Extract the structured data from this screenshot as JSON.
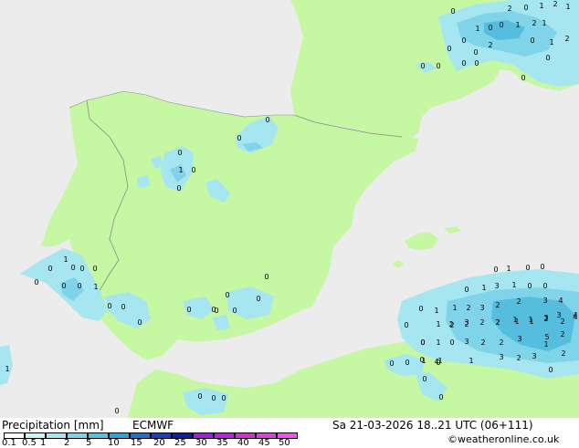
{
  "legend": {
    "title": "Precipitation [mm]",
    "model": "ECMWF",
    "datetime": "Sa 21-03-2026 18..21 UTC (06+111)",
    "credit": "©weatheronline.co.uk",
    "ticks": [
      "0.1",
      "0.5",
      "1",
      "2",
      "5",
      "10",
      "15",
      "20",
      "25",
      "30",
      "35",
      "40",
      "45",
      "50"
    ],
    "colors": [
      "#ffffff",
      "#cdf3f7",
      "#a5e8f0",
      "#7ad7ea",
      "#4cc6e0",
      "#2aa9d8",
      "#1f74d0",
      "#1940c0",
      "#0b1fa0",
      "#a020e0",
      "#c020e0",
      "#d430d8",
      "#e040e0",
      "#f050f0"
    ]
  },
  "palette": {
    "sea": "#ececec",
    "land": "#c6f7a2",
    "rain_light": "#a6e6f0",
    "rain_mid": "#7fd4ea",
    "rain_heavy": "#55bedf",
    "border": "#8a8a8a"
  },
  "map_labels": [
    {
      "t": "0"
    },
    {
      "t": "2"
    },
    {
      "t": "0"
    },
    {
      "t": "1"
    },
    {
      "t": "2"
    },
    {
      "t": "1"
    },
    {
      "t": "1"
    },
    {
      "t": "0"
    },
    {
      "t": "0"
    },
    {
      "t": "1"
    },
    {
      "t": "2"
    },
    {
      "t": "1"
    },
    {
      "t": "0"
    },
    {
      "t": "2"
    },
    {
      "t": "0"
    },
    {
      "t": "1"
    },
    {
      "t": "2"
    },
    {
      "t": "0"
    },
    {
      "t": "0"
    },
    {
      "t": "0"
    },
    {
      "t": "0"
    },
    {
      "t": "0"
    },
    {
      "t": "0"
    },
    {
      "t": "0"
    },
    {
      "t": "0"
    },
    {
      "t": "0"
    },
    {
      "t": "0"
    },
    {
      "t": "0"
    },
    {
      "t": "1"
    },
    {
      "t": "0"
    },
    {
      "t": "0"
    },
    {
      "t": "0"
    },
    {
      "t": "0"
    },
    {
      "t": "0"
    },
    {
      "t": "1"
    },
    {
      "t": "0"
    },
    {
      "t": "0"
    },
    {
      "t": "0"
    },
    {
      "t": "0"
    },
    {
      "t": "0"
    },
    {
      "t": "1"
    },
    {
      "t": "0"
    },
    {
      "t": "0"
    },
    {
      "t": "0"
    },
    {
      "t": "0"
    },
    {
      "t": "0"
    },
    {
      "t": "0"
    },
    {
      "t": "0"
    },
    {
      "t": "0"
    },
    {
      "t": "0"
    },
    {
      "t": "0"
    },
    {
      "t": "1"
    },
    {
      "t": "0"
    },
    {
      "t": "0"
    },
    {
      "t": "0"
    },
    {
      "t": "1"
    },
    {
      "t": "3"
    },
    {
      "t": "1"
    },
    {
      "t": "0"
    },
    {
      "t": "0"
    },
    {
      "t": "1"
    },
    {
      "t": "2"
    },
    {
      "t": "3"
    },
    {
      "t": "2"
    },
    {
      "t": "2"
    },
    {
      "t": "3"
    },
    {
      "t": "4"
    },
    {
      "t": "0"
    },
    {
      "t": "0"
    },
    {
      "t": "1"
    },
    {
      "t": "2"
    },
    {
      "t": "3"
    },
    {
      "t": "2"
    },
    {
      "t": "1"
    },
    {
      "t": "1"
    },
    {
      "t": "3"
    },
    {
      "t": "3"
    },
    {
      "t": "4"
    },
    {
      "t": "0"
    },
    {
      "t": "1"
    },
    {
      "t": "2"
    },
    {
      "t": "2"
    },
    {
      "t": "2"
    },
    {
      "t": "2"
    },
    {
      "t": "1"
    },
    {
      "t": "1"
    },
    {
      "t": "2"
    },
    {
      "t": "2"
    },
    {
      "t": "4"
    },
    {
      "t": "0"
    },
    {
      "t": "1"
    },
    {
      "t": "0"
    },
    {
      "t": "3"
    },
    {
      "t": "2"
    },
    {
      "t": "2"
    },
    {
      "t": "3"
    },
    {
      "t": "5"
    },
    {
      "t": "2"
    },
    {
      "t": "1"
    },
    {
      "t": "0"
    },
    {
      "t": "0"
    },
    {
      "t": "1"
    },
    {
      "t": "4"
    },
    {
      "t": "1"
    },
    {
      "t": "3"
    },
    {
      "t": "2"
    },
    {
      "t": "3"
    },
    {
      "t": "2"
    },
    {
      "t": "0"
    },
    {
      "t": "1"
    },
    {
      "t": "0"
    },
    {
      "t": "0"
    },
    {
      "t": "1"
    },
    {
      "t": "0"
    },
    {
      "t": "0"
    },
    {
      "t": "0"
    },
    {
      "t": "0"
    },
    {
      "t": "0"
    },
    {
      "t": "0"
    }
  ]
}
